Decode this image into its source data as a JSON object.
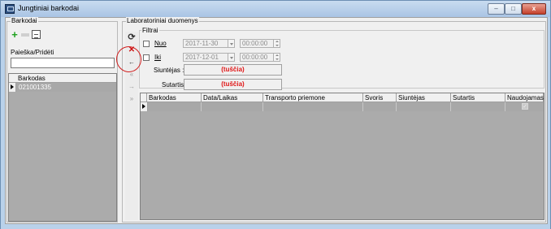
{
  "window": {
    "title": "Jungtiniai barkodai",
    "buttons": {
      "minimize": "–",
      "maximize": "□",
      "close": "x"
    }
  },
  "left_panel": {
    "group_title": "Barkodai",
    "toolbar": {
      "add_icon": "plus-icon",
      "remove_icon": "minus-icon",
      "print_icon": "printer-icon"
    },
    "search_label": "Paieška/Pridėti",
    "search_value": "",
    "grid": {
      "column": "Barkodas",
      "rows": [
        "021001335"
      ]
    }
  },
  "right_panel": {
    "group_title": "Laboratoriniai duomenys",
    "nav": {
      "refresh_icon": "refresh-icon",
      "clear_icon": "x-icon",
      "back_icon": "arrow-left-icon",
      "first_icon": "double-left-icon",
      "next_icon": "arrow-right-icon",
      "last_icon": "double-right-icon"
    },
    "filter": {
      "title": "Filtrai",
      "from_label": "Nuo",
      "from_date": "2017-11-30",
      "from_time": "00:00:00",
      "to_label": "Iki",
      "to_date": "2017-12-01",
      "to_time": "00:00:00",
      "sender_label": "Siuntėjas :",
      "sender_value": "(tuščia)",
      "contract_label": "Sutartis :",
      "contract_value": "(tuščia)"
    },
    "grid": {
      "columns": [
        "Barkodas",
        "Data/Laikas",
        "Transporto priemone",
        "Svoris",
        "Siuntėjas",
        "Sutartis",
        "Naudojamas"
      ],
      "rows": [
        {
          "naudojamas": true
        }
      ]
    }
  },
  "colors": {
    "accent_red": "#e01616",
    "annotation_red": "#d11f1f",
    "selected_row": "#a8a8a8"
  }
}
